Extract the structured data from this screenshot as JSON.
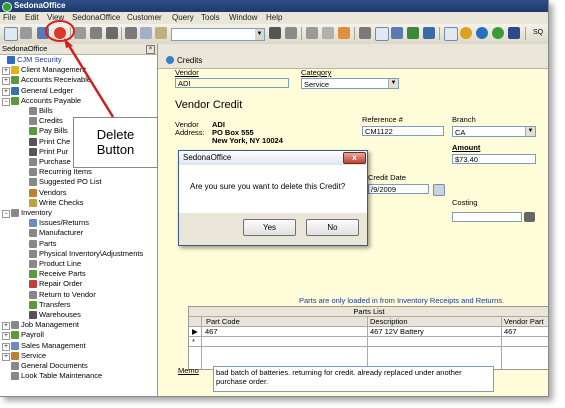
{
  "app": {
    "title": "SedonaOffice"
  },
  "menu": [
    "File",
    "Edit",
    "View",
    "SedonaOffice",
    "Customer",
    "Query",
    "Tools",
    "Window",
    "Help"
  ],
  "toolbar": {
    "trailing_text": "SQ"
  },
  "panel": {
    "title": "SedonaOffice"
  },
  "tree": [
    {
      "label": "CJM Security",
      "icon": "company-icon",
      "color": "#2a6fbf"
    },
    {
      "label": "Client Management",
      "icon": "client-icon",
      "color": "#e0b020"
    },
    {
      "label": "Accounts Receivable",
      "icon": "receivable-icon",
      "color": "#5a9a3a"
    },
    {
      "label": "General Ledger",
      "icon": "ledger-icon",
      "color": "#3a6fb0"
    },
    {
      "label": "Accounts Payable",
      "icon": "payable-icon",
      "color": "#5a9a3a"
    },
    {
      "label": "Bills",
      "icon": "bills-icon",
      "color": "#888888"
    },
    {
      "label": "Credits",
      "icon": "credits-icon",
      "color": "#888888"
    },
    {
      "label": "Pay Bills",
      "icon": "pay-bills-icon",
      "color": "#5a9a3a"
    },
    {
      "label": "Print Che",
      "icon": "print-checks-icon",
      "color": "#555555"
    },
    {
      "label": "Print Pur",
      "icon": "print-purchase-icon",
      "color": "#555555"
    },
    {
      "label": "Purchase",
      "icon": "purchase-icon",
      "color": "#888888"
    },
    {
      "label": "Recurring Items",
      "icon": "recurring-icon",
      "color": "#888888"
    },
    {
      "label": "Suggested PO List",
      "icon": "suggested-po-icon",
      "color": "#888888"
    },
    {
      "label": "Vendors",
      "icon": "vendors-icon",
      "color": "#c08030"
    },
    {
      "label": "Write Checks",
      "icon": "write-checks-icon",
      "color": "#c0a040"
    },
    {
      "label": "Inventory",
      "icon": "inventory-icon",
      "color": "#888888"
    },
    {
      "label": "Issues/Returns",
      "icon": "issues-icon",
      "color": "#6a8ac0"
    },
    {
      "label": "Manufacturer",
      "icon": "manufacturer-icon",
      "color": "#888888"
    },
    {
      "label": "Parts",
      "icon": "parts-icon",
      "color": "#888888"
    },
    {
      "label": "Physical Inventory\\Adjustments",
      "icon": "physical-inventory-icon",
      "color": "#888888"
    },
    {
      "label": "Product Line",
      "icon": "product-line-icon",
      "color": "#888888"
    },
    {
      "label": "Receive Parts",
      "icon": "receive-parts-icon",
      "color": "#5a9a3a"
    },
    {
      "label": "Repair Order",
      "icon": "repair-order-icon",
      "color": "#c04040"
    },
    {
      "label": "Return to Vendor",
      "icon": "return-vendor-icon",
      "color": "#888888"
    },
    {
      "label": "Transfers",
      "icon": "transfers-icon",
      "color": "#5a9a3a"
    },
    {
      "label": "Warehouses",
      "icon": "warehouses-icon",
      "color": "#555555"
    },
    {
      "label": "Job Management",
      "icon": "job-icon",
      "color": "#888888"
    },
    {
      "label": "Payroll",
      "icon": "payroll-icon",
      "color": "#5a9a3a"
    },
    {
      "label": "Sales Management",
      "icon": "sales-icon",
      "color": "#6a8ac0"
    },
    {
      "label": "Service",
      "icon": "service-icon",
      "color": "#c08030"
    },
    {
      "label": "General Documents",
      "icon": "documents-icon",
      "color": "#888888"
    },
    {
      "label": "Look Table Maintenance",
      "icon": "look-table-icon",
      "color": "#888888"
    }
  ],
  "credits": {
    "title": "Credits",
    "vendor_label": "Vendor",
    "vendor_value": "ADI",
    "category_label": "Category",
    "category_value": "Service",
    "heading": "Vendor Credit",
    "vendor_field_label": "Vendor",
    "address_label": "Address:",
    "vendor_name": "ADI",
    "address_line1": "PO Box 555",
    "address_line2": "New York, NY  10024",
    "reference_label": "Reference #",
    "reference_value": "CM1122",
    "branch_label": "Branch",
    "branch_value": "CA",
    "amount_label": "Amount",
    "amount_value": "$73.40",
    "credit_date_label": "Credit Date",
    "credit_date_value": "/9/2009",
    "costing_label": "Costing",
    "parts_note": "Parts are only loaded in from Inventory Receipts and Returns.",
    "parts_list_title": "Parts List",
    "columns": [
      "Part Code",
      "Description",
      "Vendor Part"
    ],
    "rows": [
      {
        "part_code": "467",
        "description": "467 12V Battery",
        "vendor_part": "467"
      }
    ],
    "new_row_marker": "*",
    "memo_label": "Memo",
    "memo_value": "bad batch of batteries. returning for credit. already replaced under another purchase order."
  },
  "dialog": {
    "title": "SedonaOffice",
    "message": "Are you sure you want to delete this Credit?",
    "yes": "Yes",
    "no": "No",
    "close": "x"
  },
  "callout": {
    "text": "Delete Button"
  }
}
